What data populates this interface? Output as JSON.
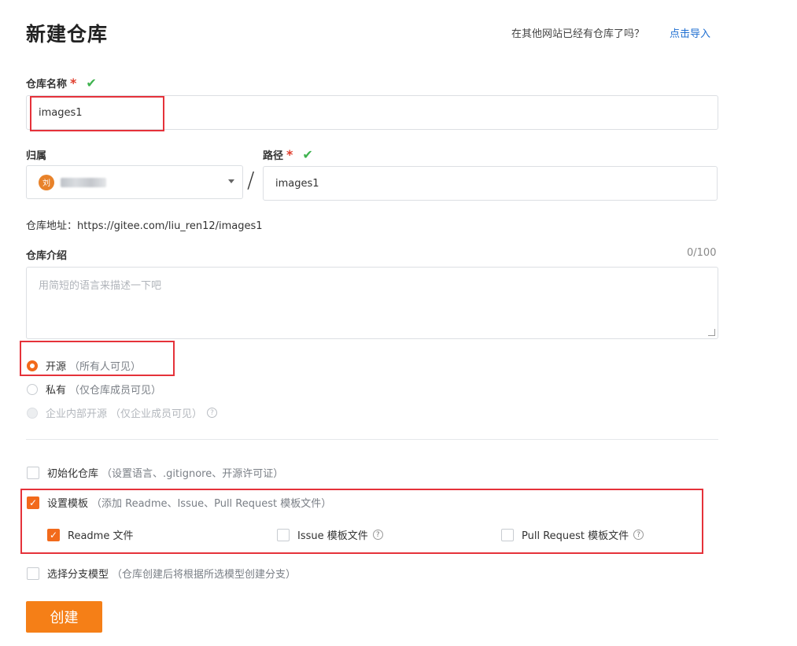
{
  "header": {
    "title": "新建仓库",
    "import_hint": "在其他网站已经有仓库了吗？",
    "import_link": "点击导入"
  },
  "repo_name": {
    "label": "仓库名称",
    "required_mark": "*",
    "valid_mark": "✔",
    "value": "images1"
  },
  "owner": {
    "label": "归属",
    "avatar_text": "刘"
  },
  "path": {
    "label": "路径",
    "required_mark": "*",
    "valid_mark": "✔",
    "separator": "/",
    "value": "images1"
  },
  "repo_url": {
    "label": "仓库地址：",
    "value": "https://gitee.com/liu_ren12/images1"
  },
  "description": {
    "label": "仓库介绍",
    "counter": "0/100",
    "placeholder": "用简短的语言来描述一下吧"
  },
  "visibility": {
    "options": [
      {
        "label": "开源",
        "hint": "（所有人可见）",
        "selected": true,
        "disabled": false
      },
      {
        "label": "私有",
        "hint": "（仅仓库成员可见）",
        "selected": false,
        "disabled": false
      },
      {
        "label": "企业内部开源",
        "hint": "（仅企业成员可见）",
        "selected": false,
        "disabled": true
      }
    ],
    "help_icon": "question-circle-icon"
  },
  "options": {
    "init_repo": {
      "label": "初始化仓库",
      "hint": "（设置语言、.gitignore、开源许可证）",
      "checked": false
    },
    "set_template": {
      "label": "设置模板",
      "hint": "（添加 Readme、Issue、Pull Request 模板文件）",
      "checked": true
    },
    "templates": [
      {
        "label": "Readme 文件",
        "checked": true,
        "help": false
      },
      {
        "label": "Issue 模板文件",
        "checked": false,
        "help": true
      },
      {
        "label": "Pull Request 模板文件",
        "checked": false,
        "help": true
      }
    ],
    "branch_model": {
      "label": "选择分支模型",
      "hint": "（仓库创建后将根据所选模型创建分支）",
      "checked": false
    }
  },
  "submit": {
    "label": "创建"
  },
  "colors": {
    "accent": "#f26a1b",
    "button": "#f57f17",
    "link": "#1f6fd1",
    "valid": "#3fb34f",
    "annotation": "#e5323a"
  }
}
